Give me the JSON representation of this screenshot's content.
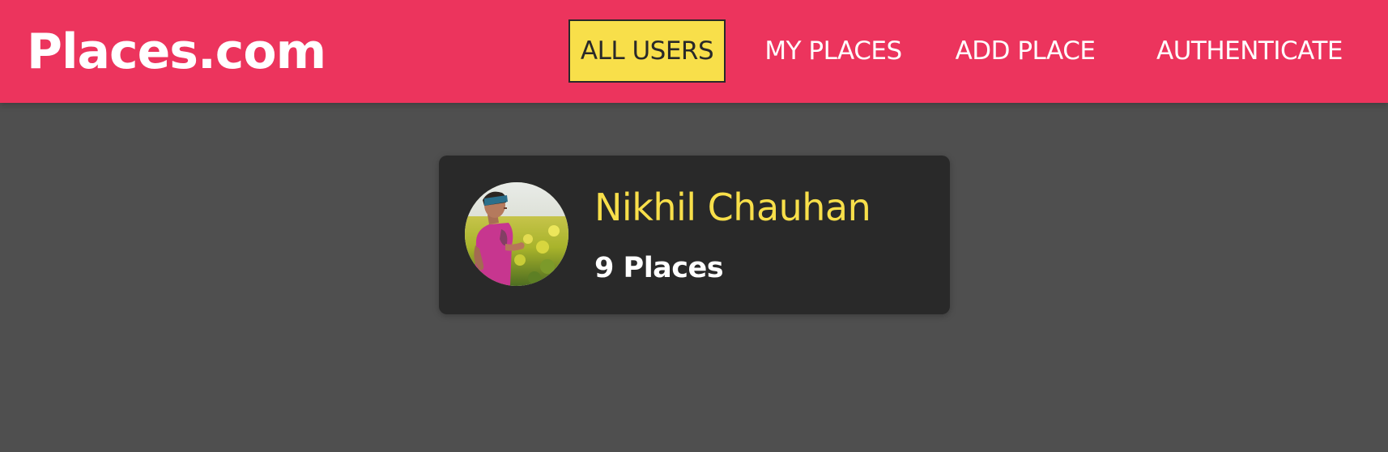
{
  "header": {
    "logo": "Places.com",
    "nav": [
      {
        "label": "ALL USERS",
        "active": true
      },
      {
        "label": "MY PLACES",
        "active": false
      },
      {
        "label": "ADD PLACE",
        "active": false
      },
      {
        "label": "AUTHENTICATE",
        "active": false
      }
    ]
  },
  "users": [
    {
      "name": "Nikhil Chauhan",
      "places": "9 Places",
      "avatar_icon": "user-photo"
    }
  ],
  "colors": {
    "header_bg": "#ec345d",
    "page_bg": "#4f4f4f",
    "card_bg": "#292929",
    "accent_yellow": "#f8df4a",
    "text_white": "#ffffff"
  }
}
